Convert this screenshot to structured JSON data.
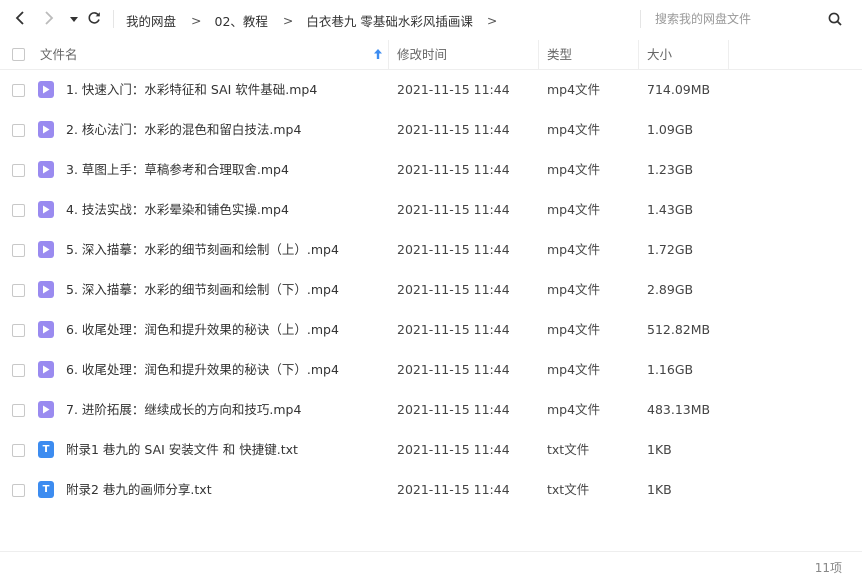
{
  "nav": {
    "dropdown_icon": "triangle-down",
    "refresh_icon": "refresh"
  },
  "breadcrumb": {
    "items": [
      "我的网盘",
      "02、教程",
      "白衣巷九 零基础水彩风插画课"
    ],
    "separator": ">"
  },
  "search": {
    "placeholder": "搜索我的网盘文件",
    "value": ""
  },
  "table": {
    "columns": {
      "name": "文件名",
      "mtime": "修改时间",
      "type": "类型",
      "size": "大小"
    },
    "sort_indicator": "arrow-up",
    "rows": [
      {
        "name": "1. 快速入门：水彩特征和 SAI 软件基础.mp4",
        "mtime": "2021-11-15 11:44",
        "type": "mp4文件",
        "size": "714.09MB",
        "icon": "video"
      },
      {
        "name": "2. 核心法门：水彩的混色和留白技法.mp4",
        "mtime": "2021-11-15 11:44",
        "type": "mp4文件",
        "size": "1.09GB",
        "icon": "video"
      },
      {
        "name": "3. 草图上手：草稿参考和合理取舍.mp4",
        "mtime": "2021-11-15 11:44",
        "type": "mp4文件",
        "size": "1.23GB",
        "icon": "video"
      },
      {
        "name": "4. 技法实战：水彩晕染和铺色实操.mp4",
        "mtime": "2021-11-15 11:44",
        "type": "mp4文件",
        "size": "1.43GB",
        "icon": "video"
      },
      {
        "name": "5. 深入描摹：水彩的细节刻画和绘制（上）.mp4",
        "mtime": "2021-11-15 11:44",
        "type": "mp4文件",
        "size": "1.72GB",
        "icon": "video"
      },
      {
        "name": "5. 深入描摹：水彩的细节刻画和绘制（下）.mp4",
        "mtime": "2021-11-15 11:44",
        "type": "mp4文件",
        "size": "2.89GB",
        "icon": "video"
      },
      {
        "name": "6. 收尾处理：润色和提升效果的秘诀（上）.mp4",
        "mtime": "2021-11-15 11:44",
        "type": "mp4文件",
        "size": "512.82MB",
        "icon": "video"
      },
      {
        "name": "6. 收尾处理：润色和提升效果的秘诀（下）.mp4",
        "mtime": "2021-11-15 11:44",
        "type": "mp4文件",
        "size": "1.16GB",
        "icon": "video"
      },
      {
        "name": "7. 进阶拓展：继续成长的方向和技巧.mp4",
        "mtime": "2021-11-15 11:44",
        "type": "mp4文件",
        "size": "483.13MB",
        "icon": "video"
      },
      {
        "name": "附录1 巷九的 SAI 安装文件 和 快捷键.txt",
        "mtime": "2021-11-15 11:44",
        "type": "txt文件",
        "size": "1KB",
        "icon": "txt"
      },
      {
        "name": "附录2 巷九的画师分享.txt",
        "mtime": "2021-11-15 11:44",
        "type": "txt文件",
        "size": "1KB",
        "icon": "txt"
      }
    ]
  },
  "icons": {
    "video_glyph": "play-triangle",
    "txt_glyph": "T"
  },
  "colors": {
    "video_icon": "#9a8bf0",
    "txt_icon": "#3d8cf0",
    "sort_arrow": "#3d8cf0"
  },
  "footer": {
    "count": "11项"
  }
}
